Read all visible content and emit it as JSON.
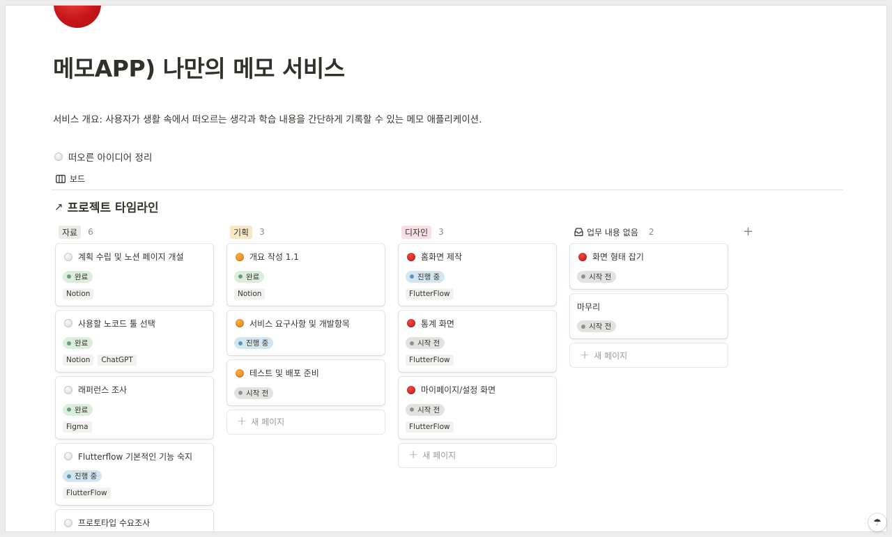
{
  "page": {
    "title": "메모APP) 나만의 메모 서비스",
    "description": "서비스 개요: 사용자가 생활 속에서 떠오르는 생각과 학습 내용을 간단하게 기록할 수 있는 메모 애플리케이션.",
    "linked_page": "떠오른 아이디어 정리",
    "icon": "red-circle-icon"
  },
  "view": {
    "icon": "board-icon",
    "label": "보드"
  },
  "board": {
    "title": "프로젝트 타임라인",
    "title_icon": "north-east-arrow-icon"
  },
  "new_page_label": "새 페이지",
  "columns": [
    {
      "label": "자료",
      "count": "6",
      "color": "#ebeae7",
      "cards": [
        {
          "title": "계획 수립 및 노션 페이지 개설",
          "status": "완료",
          "tags": [
            "Notion"
          ]
        },
        {
          "title": "사용할 노코드 툴 선택",
          "status": "완료",
          "tags": [
            "Notion",
            "ChatGPT"
          ]
        },
        {
          "title": "래퍼런스 조사",
          "status": "완료",
          "tags": [
            "Figma"
          ]
        },
        {
          "title": "Flutterflow 기본적인 기능 숙지",
          "status": "진행 중",
          "tags": [
            "FlutterFlow"
          ]
        },
        {
          "title": "프로토타입 수요조사",
          "status": "",
          "tags": []
        }
      ]
    },
    {
      "label": "기획",
      "count": "3",
      "color": "#f9e8c7",
      "cards": [
        {
          "title": "개요 작성 1.1",
          "status": "완료",
          "tags": [
            "Notion"
          ]
        },
        {
          "title": "서비스 요구사항 및 개발항목",
          "status": "진행 중",
          "tags": []
        },
        {
          "title": "테스트 및 배포 준비",
          "status": "시작 전",
          "tags": []
        }
      ]
    },
    {
      "label": "디자인",
      "count": "3",
      "color": "#f6e0e6",
      "cards": [
        {
          "title": "홈화면 제작",
          "status": "진행 중",
          "tags": [
            "FlutterFlow"
          ]
        },
        {
          "title": "통계 화면",
          "status": "시작 전",
          "tags": [
            "FlutterFlow"
          ]
        },
        {
          "title": "마이페이지/설정 화면",
          "status": "시작 전",
          "tags": [
            "FlutterFlow"
          ]
        }
      ]
    },
    {
      "label": "업무 내용 없음",
      "count": "2",
      "icon": "inbox-icon",
      "cards": [
        {
          "title": "화면 형태 잡기",
          "status": "시작 전",
          "tags": []
        },
        {
          "title": "마무리",
          "status": "시작 전",
          "tags": []
        }
      ]
    }
  ],
  "status_colors": {
    "완료": "#dbeddb",
    "진행 중": "#d3e5ef",
    "시작 전": "#e3e2e0"
  }
}
